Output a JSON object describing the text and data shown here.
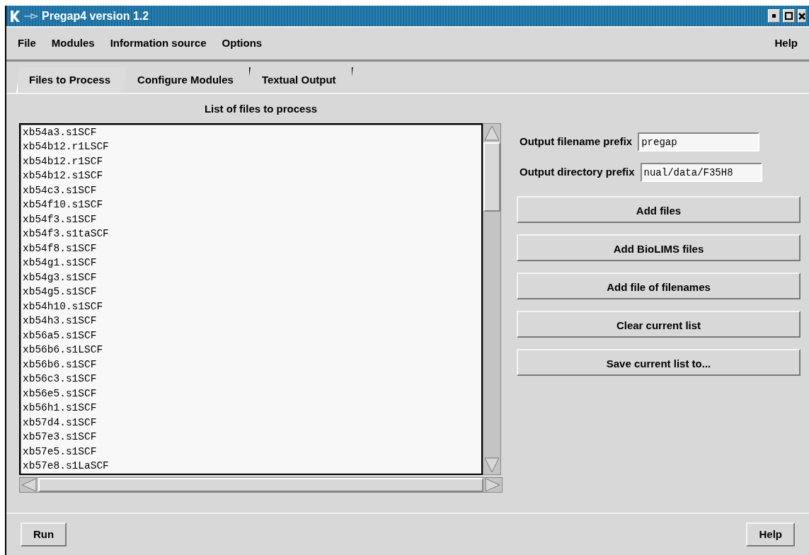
{
  "window": {
    "title": "Pregap4 version 1.2"
  },
  "menu": [
    {
      "label": "File"
    },
    {
      "label": "Modules"
    },
    {
      "label": "Information source"
    },
    {
      "label": "Options"
    }
  ],
  "menu_help": {
    "label": "Help"
  },
  "tabs": [
    {
      "label": "Files to Process",
      "selected": true
    },
    {
      "label": "Configure Modules",
      "selected": false
    },
    {
      "label": "Textual Output",
      "selected": false
    }
  ],
  "file_list": {
    "title": "List of files to process",
    "items": [
      "xb54a3.s1SCF",
      "xb54b12.r1LSCF",
      "xb54b12.r1SCF",
      "xb54b12.s1SCF",
      "xb54c3.s1SCF",
      "xb54f10.s1SCF",
      "xb54f3.s1SCF",
      "xb54f3.s1taSCF",
      "xb54f8.s1SCF",
      "xb54g1.s1SCF",
      "xb54g3.s1SCF",
      "xb54g5.s1SCF",
      "xb54h10.s1SCF",
      "xb54h3.s1SCF",
      "xb56a5.s1SCF",
      "xb56b6.s1LSCF",
      "xb56b6.s1SCF",
      "xb56c3.s1SCF",
      "xb56e5.s1SCF",
      "xb56h1.s1SCF",
      "xb57d4.s1SCF",
      "xb57e3.s1SCF",
      "xb57e5.s1SCF",
      "xb57e8.s1LaSCF"
    ]
  },
  "fields": [
    {
      "label": "Output filename prefix",
      "value": "pregap"
    },
    {
      "label": "Output directory prefix",
      "value": "nual/data/F35H8"
    }
  ],
  "actions": [
    {
      "label": "Add files"
    },
    {
      "label": "Add BioLIMS files"
    },
    {
      "label": "Add file of filenames"
    },
    {
      "label": "Clear current list"
    },
    {
      "label": "Save current list to..."
    }
  ],
  "footer": {
    "run": "Run",
    "help": "Help"
  }
}
